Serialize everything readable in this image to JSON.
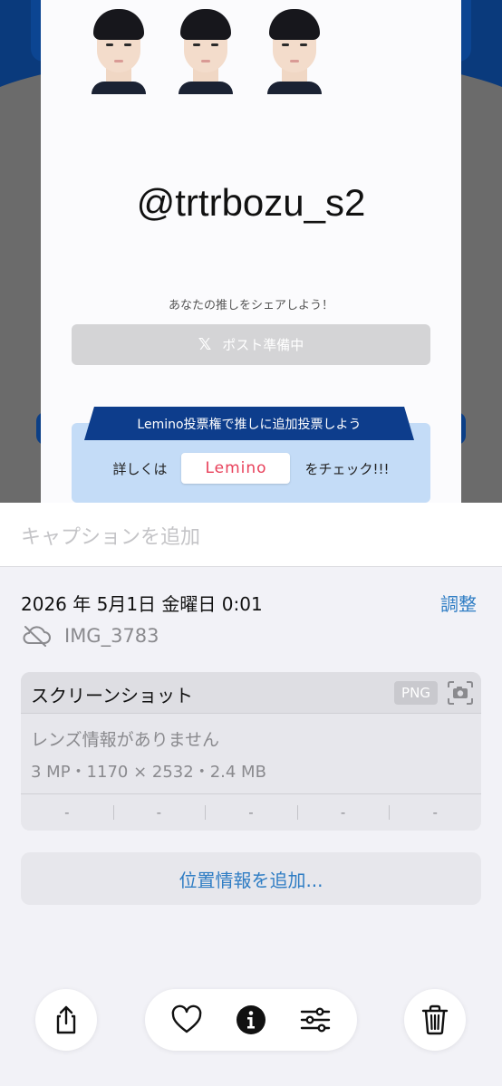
{
  "preview": {
    "handle": "@trtrbozu_s2",
    "share_prompt": "あなたの推しをシェアしよう！",
    "post_button": {
      "icon": "x-logo-icon",
      "label": "ポスト準備中"
    },
    "lemino_banner": "Lemino投票権で推しに追加投票しよう",
    "check_prefix": "詳しくは",
    "lemino_logo": "Lemino",
    "check_suffix": "をチェック!!!",
    "colors": {
      "accent_blue": "#0d3d8c",
      "lemino_pink": "#e8405a",
      "box_blue": "#c4dcf7"
    }
  },
  "caption": {
    "placeholder": "キャプションを追加"
  },
  "info": {
    "date": "2026 年 5月1日 金曜日 0:01",
    "adjust_label": "調整",
    "cloud_icon": "cloud-slash-icon",
    "file_name": "IMG_3783"
  },
  "metadata": {
    "title": "スクリーンショット",
    "format_badge": "PNG",
    "camera_icon": "screenshot-camera-icon",
    "lens": "レンズ情報がありません",
    "specs": "3 MP・1170 × 2532・2.4 MB",
    "exif": [
      "-",
      "-",
      "-",
      "-",
      "-"
    ]
  },
  "location": {
    "label": "位置情報を追加..."
  },
  "toolbar": {
    "icons": [
      "share-icon",
      "heart-icon",
      "info-icon",
      "adjust-icon",
      "trash-icon"
    ],
    "link_color": "#2f7dc4"
  }
}
